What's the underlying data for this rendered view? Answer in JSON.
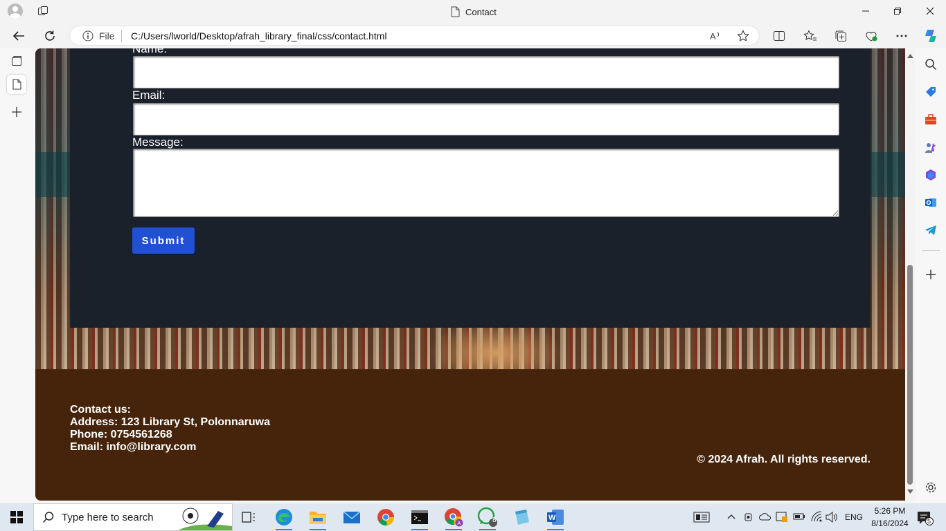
{
  "browser": {
    "tab_title": "Contact",
    "address_prefix": "File",
    "url": "C:/Users/lworld/Desktop/afrah_library_final/css/contact.html"
  },
  "form": {
    "name_label": "Name:",
    "email_label": "Email:",
    "message_label": "Message:",
    "submit_label": "Submit"
  },
  "footer": {
    "contact_heading": "Contact us:",
    "address": "Address: 123 Library St, Polonnaruwa",
    "phone": "Phone: 0754561268",
    "email": "Email: info@library.com",
    "copyright": "© 2024 Afrah. All rights reserved."
  },
  "taskbar": {
    "search_placeholder": "Type here to search",
    "language": "ENG",
    "time": "5:26 PM",
    "date": "8/16/2024",
    "whatsapp_badge": "8",
    "notification_count": "5"
  },
  "colors": {
    "panel": "#1b212b",
    "submit": "#2250d3",
    "footer": "#45240b"
  },
  "icons": [
    "profile-icon",
    "workspaces-icon",
    "tab-page-icon",
    "minimize-icon",
    "restore-icon",
    "close-icon",
    "back-icon",
    "refresh-icon",
    "info-icon",
    "read-aloud-icon",
    "favorite-star-icon",
    "split-screen-icon",
    "favorites-icon",
    "collections-icon",
    "browser-essentials-icon",
    "more-icon",
    "copilot-icon",
    "search-icon",
    "shopping-icon",
    "tools-icon",
    "games-icon",
    "office-icon",
    "outlook-icon",
    "telegram-icon",
    "add-icon",
    "settings-icon",
    "windows-icon"
  ]
}
